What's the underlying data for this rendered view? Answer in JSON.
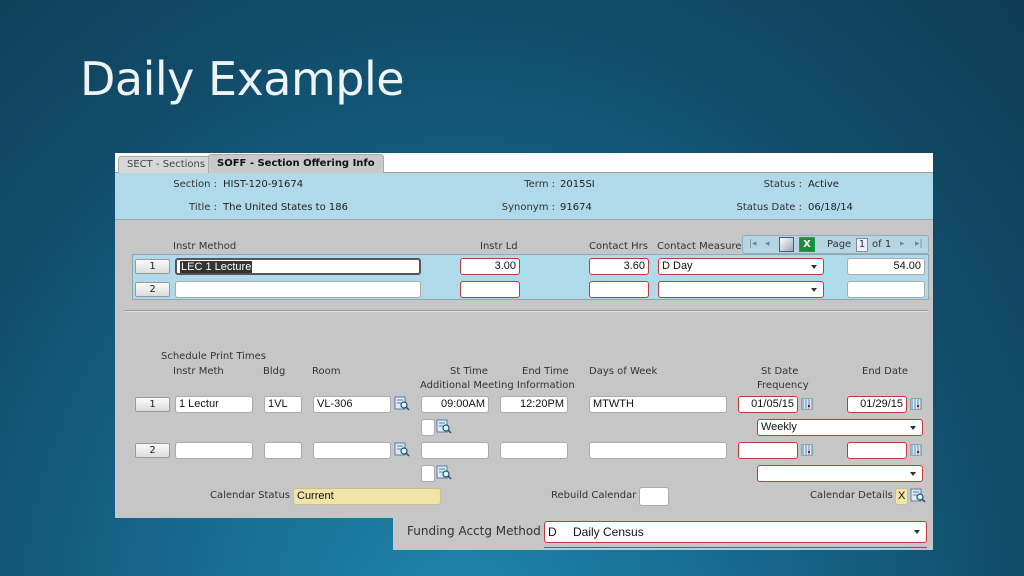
{
  "slide": {
    "title": "Daily Example"
  },
  "tabs": [
    {
      "label": "SECT - Sections",
      "active": false
    },
    {
      "label": "SOFF - Section Offering Info",
      "active": true
    }
  ],
  "header": {
    "section_label": "Section :",
    "section_value": "HIST-120-91674",
    "title_label": "Title :",
    "title_value": "The United States to 186",
    "term_label": "Term :",
    "term_value": "2015SI",
    "synonym_label": "Synonym :",
    "synonym_value": "91674",
    "status_label": "Status :",
    "status_value": "Active",
    "status_date_label": "Status Date :",
    "status_date_value": "06/18/14"
  },
  "instr_grid": {
    "columns": {
      "method": "Instr Method",
      "load": "Instr Ld",
      "contact_hrs": "Contact Hrs",
      "contact_measure": "Contact Measure"
    },
    "rows": [
      {
        "num": "1",
        "method": "LEC 1 Lecture",
        "load": "3.00",
        "contact_hrs": "3.60",
        "contact_measure": "D Day",
        "total": "54.00"
      },
      {
        "num": "2",
        "method": "",
        "load": "",
        "contact_hrs": "",
        "contact_measure": "",
        "total": ""
      }
    ]
  },
  "pager": {
    "page_label": "Page",
    "page_value": "1",
    "of_label": "of 1"
  },
  "schedule": {
    "print_times_label": "Schedule Print Times",
    "columns": {
      "instr_meth": "Instr Meth",
      "bldg": "Bldg",
      "room": "Room",
      "st_time": "St Time",
      "end_time": "End Time",
      "additional": "Additional Meeting Information",
      "days": "Days of Week",
      "st_date": "St Date",
      "frequency": "Frequency",
      "end_date": "End Date"
    },
    "rows": [
      {
        "num": "1",
        "instr_meth": "1 Lectur",
        "bldg": "1VL",
        "room": "VL-306",
        "st_time": "09:00AM",
        "end_time": "12:20PM",
        "days": "MTWTH",
        "st_date": "01/05/15",
        "end_date": "01/29/15",
        "frequency": "Weekly"
      },
      {
        "num": "2",
        "instr_meth": "",
        "bldg": "",
        "room": "",
        "st_time": "",
        "end_time": "",
        "days": "",
        "st_date": "",
        "end_date": "",
        "frequency": ""
      }
    ]
  },
  "footer": {
    "calendar_status_label": "Calendar Status",
    "calendar_status_value": "Current",
    "rebuild_label": "Rebuild Calendar",
    "rebuild_value": "",
    "details_label": "Calendar Details",
    "details_value": "X"
  },
  "funding": {
    "label": "Funding Acctg Method",
    "code": "D",
    "value": "Daily Census"
  }
}
